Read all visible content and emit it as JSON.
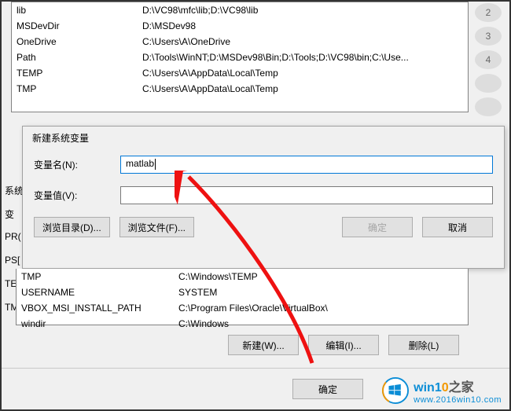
{
  "sysvars": [
    {
      "name": "lib",
      "value": "D:\\VC98\\mfc\\lib;D:\\VC98\\lib"
    },
    {
      "name": "MSDevDir",
      "value": "D:\\MSDev98"
    },
    {
      "name": "OneDrive",
      "value": "C:\\Users\\A\\OneDrive"
    },
    {
      "name": "Path",
      "value": "D:\\Tools\\WinNT;D:\\MSDev98\\Bin;D:\\Tools;D:\\VC98\\bin;C:\\Use..."
    },
    {
      "name": "TEMP",
      "value": "C:\\Users\\A\\AppData\\Local\\Temp"
    },
    {
      "name": "TMP",
      "value": "C:\\Users\\A\\AppData\\Local\\Temp"
    }
  ],
  "dialog": {
    "title": "新建系统变量",
    "name_label": "变量名(N):",
    "name_value": "matlab",
    "value_label": "变量值(V):",
    "value_value": "",
    "browse_dir": "浏览目录(D)...",
    "browse_file": "浏览文件(F)...",
    "ok": "确定",
    "cancel": "取消"
  },
  "left_labels": {
    "l0": "系统变",
    "l1": "变",
    "l2": "PR(",
    "l3": "PS[",
    "l4": "TE[",
    "l5": "TM"
  },
  "botvars": [
    {
      "name": "TMP",
      "value": "C:\\Windows\\TEMP"
    },
    {
      "name": "USERNAME",
      "value": "SYSTEM"
    },
    {
      "name": "VBOX_MSI_INSTALL_PATH",
      "value": "C:\\Program Files\\Oracle\\VirtualBox\\"
    },
    {
      "name": "windir",
      "value": "C:\\Windows"
    }
  ],
  "mid_buttons": {
    "new": "新建(W)...",
    "edit": "编辑(I)...",
    "delete": "删除(L)"
  },
  "bottom_ok": "确定",
  "watermark": {
    "brand_a": "win1",
    "brand_b": "0",
    "brand_c": "之家",
    "url": "www.2016win10.com"
  }
}
